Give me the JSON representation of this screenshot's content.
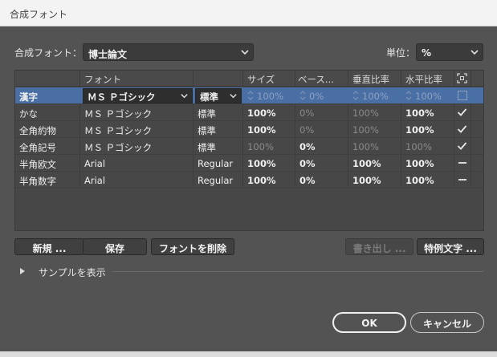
{
  "window": {
    "title": "合成フォント"
  },
  "header": {
    "composite_label": "合成フォント：",
    "composite_value": "博士論文",
    "unit_label": "単位：",
    "unit_value": "%"
  },
  "table": {
    "columns": [
      "フォント",
      "サイズ",
      "ベース...",
      "垂直比率",
      "水平比率"
    ],
    "rows": [
      {
        "name": "漢字",
        "font": "ＭＳ Ｐゴシック",
        "style": "標準",
        "size": "100%",
        "base": "0%",
        "vscale": "100%",
        "hscale": "100%",
        "mark": "checkbox"
      },
      {
        "name": "かな",
        "font": "ＭＳ Ｐゴシック",
        "style": "標準",
        "size": "100%",
        "base": "0%",
        "vscale": "100%",
        "hscale": "100%",
        "mark": "check"
      },
      {
        "name": "全角約物",
        "font": "ＭＳ Ｐゴシック",
        "style": "標準",
        "size": "100%",
        "base": "0%",
        "vscale": "100%",
        "hscale": "100%",
        "mark": "check"
      },
      {
        "name": "全角記号",
        "font": "ＭＳ Ｐゴシック",
        "style": "標準",
        "size": "100%",
        "base": "0%",
        "vscale": "100%",
        "hscale": "100%",
        "mark": "check"
      },
      {
        "name": "半角欧文",
        "font": "Arial",
        "style": "Regular",
        "size": "100%",
        "base": "0%",
        "vscale": "100%",
        "hscale": "100%",
        "mark": "dash"
      },
      {
        "name": "半角数字",
        "font": "Arial",
        "style": "Regular",
        "size": "100%",
        "base": "0%",
        "vscale": "100%",
        "hscale": "100%",
        "mark": "dash"
      }
    ]
  },
  "buttons": {
    "new": "新規 ...",
    "save": "保存",
    "delete_font": "フォントを削除",
    "export": "書き出し ...",
    "special_chars": "特例文字 ...",
    "ok": "OK",
    "cancel": "キャンセル"
  },
  "sample": {
    "label": "サンプルを表示"
  },
  "colors": {
    "selection": "#4a6fa5",
    "panel": "#535353"
  }
}
